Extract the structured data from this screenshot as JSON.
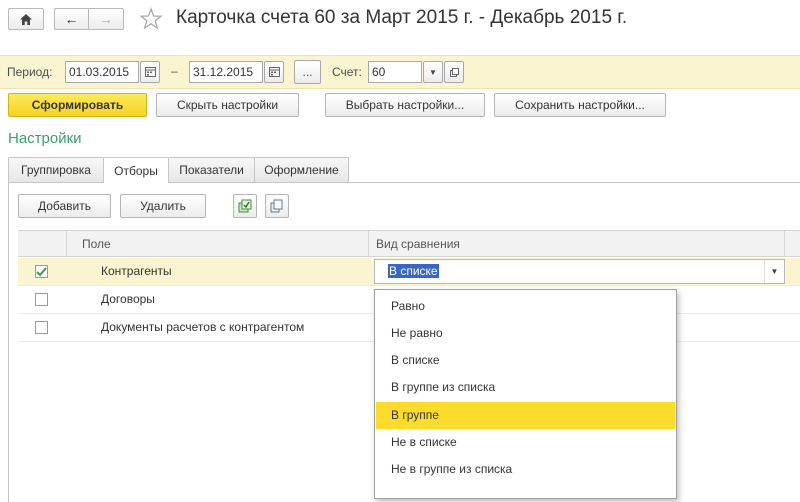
{
  "window": {
    "title": "Карточка счета 60 за Март 2015 г. - Декабрь 2015 г."
  },
  "period": {
    "label": "Период:",
    "from": "01.03.2015",
    "dash": "–",
    "to": "31.12.2015",
    "more_label": "...",
    "account_label": "Счет:",
    "account_value": "60"
  },
  "toolbar": {
    "generate": "Сформировать",
    "hide_settings": "Скрыть настройки",
    "choose_settings": "Выбрать настройки...",
    "save_settings": "Сохранить настройки..."
  },
  "settings": {
    "title": "Настройки",
    "tabs": [
      {
        "label": "Группировка"
      },
      {
        "label": "Отборы"
      },
      {
        "label": "Показатели"
      },
      {
        "label": "Оформление"
      }
    ],
    "active_tab": "Отборы"
  },
  "filters": {
    "add_button": "Добавить",
    "delete_button": "Удалить",
    "columns": {
      "field": "Поле",
      "comparison": "Вид сравнения"
    },
    "rows": [
      {
        "field": "Контрагенты",
        "checked": true,
        "comparison": "В списке"
      },
      {
        "field": "Договоры",
        "checked": false,
        "comparison": ""
      },
      {
        "field": "Документы расчетов с контрагентом",
        "checked": false,
        "comparison": ""
      }
    ]
  },
  "comparison_dropdown": {
    "options": [
      "Равно",
      "Не равно",
      "В списке",
      "В группе из списка",
      "В группе",
      "Не в списке",
      "Не в группе из списка"
    ],
    "highlighted": "В группе"
  },
  "colors": {
    "accent_yellow": "#fbdc2c",
    "panel_yellow": "#fbf4d0",
    "section_green": "#3c9f6e",
    "selection_blue": "#3965c5"
  }
}
